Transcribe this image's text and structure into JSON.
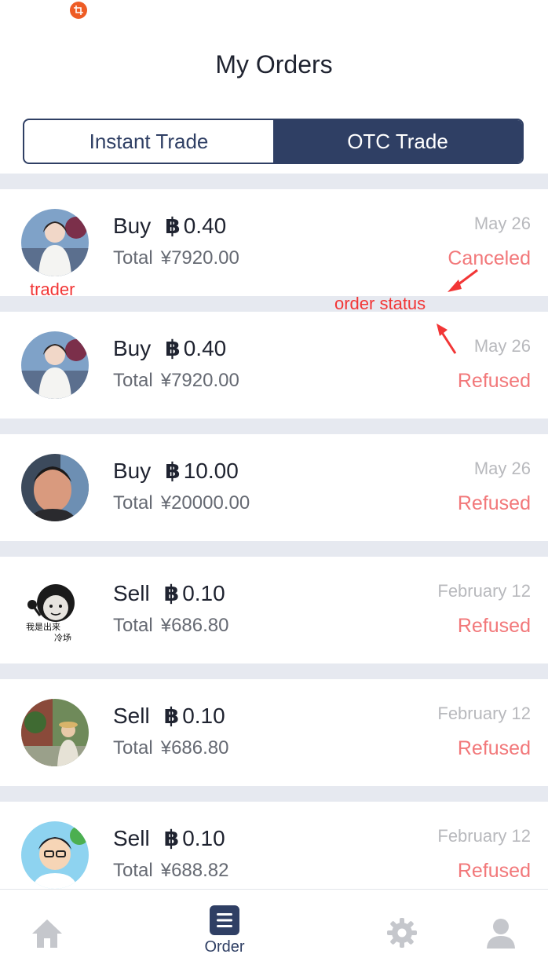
{
  "header": {
    "title": "My Orders",
    "status_icon": "crop-icon"
  },
  "segments": [
    {
      "label": "Instant Trade",
      "active": false
    },
    {
      "label": "OTC Trade",
      "active": true
    }
  ],
  "orders": [
    {
      "type": "Buy",
      "coin_symbol": "฿",
      "amount": "0.40",
      "total_label": "Total",
      "currency": "¥",
      "total": "7920.00",
      "date": "May 26",
      "status": "Canceled"
    },
    {
      "type": "Buy",
      "coin_symbol": "฿",
      "amount": "0.40",
      "total_label": "Total",
      "currency": "¥",
      "total": "7920.00",
      "date": "May 26",
      "status": "Refused"
    },
    {
      "type": "Buy",
      "coin_symbol": "฿",
      "amount": "10.00",
      "total_label": "Total",
      "currency": "¥",
      "total": "20000.00",
      "date": "May 26",
      "status": "Refused"
    },
    {
      "type": "Sell",
      "coin_symbol": "฿",
      "amount": "0.10",
      "total_label": "Total",
      "currency": "¥",
      "total": "686.80",
      "date": "February 12",
      "status": "Refused"
    },
    {
      "type": "Sell",
      "coin_symbol": "฿",
      "amount": "0.10",
      "total_label": "Total",
      "currency": "¥",
      "total": "686.80",
      "date": "February 12",
      "status": "Refused"
    },
    {
      "type": "Sell",
      "coin_symbol": "฿",
      "amount": "0.10",
      "total_label": "Total",
      "currency": "¥",
      "total": "688.82",
      "date": "February 12",
      "status": "Refused"
    }
  ],
  "sticker_text": [
    "我是出来",
    "冷场"
  ],
  "annotations": {
    "trader": "trader",
    "order_status": "order status"
  },
  "tabbar": [
    {
      "label": "",
      "icon": "home-icon",
      "active": false
    },
    {
      "label": "Order",
      "icon": "order-list-icon",
      "active": true
    },
    {
      "label": "",
      "icon": "gear-icon",
      "active": false
    },
    {
      "label": "",
      "icon": "user-icon",
      "active": false
    }
  ],
  "colors": {
    "navy": "#2f3f64",
    "status_red": "#f2787a",
    "annotation_red": "#f23636",
    "divider": "#e6e9f0"
  }
}
